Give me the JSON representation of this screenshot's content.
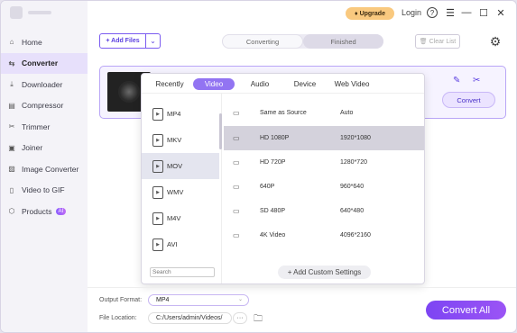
{
  "sidebar": {
    "items": [
      {
        "label": "Home",
        "icon": "home-icon"
      },
      {
        "label": "Converter",
        "icon": "converter-icon",
        "active": true
      },
      {
        "label": "Downloader",
        "icon": "download-icon"
      },
      {
        "label": "Compressor",
        "icon": "compress-icon"
      },
      {
        "label": "Trimmer",
        "icon": "scissors-icon"
      },
      {
        "label": "Joiner",
        "icon": "joiner-icon"
      },
      {
        "label": "Image Converter",
        "icon": "image-icon"
      },
      {
        "label": "Video to GIF",
        "icon": "gif-icon"
      },
      {
        "label": "Products",
        "icon": "products-icon",
        "badge": "AI"
      }
    ]
  },
  "topbar": {
    "upgrade_label": "Upgrade",
    "login_label": "Login",
    "help_glyph": "?",
    "menu_glyph": "☰",
    "minimize_glyph": "—",
    "maximize_glyph": "☐",
    "close_glyph": "✕"
  },
  "toolbar": {
    "add_files_label": "+ Add Files",
    "tabs": [
      "Converting",
      "Finished"
    ],
    "clear_list_label": "Clear List"
  },
  "file_card": {
    "convert_label": "Convert"
  },
  "format_popup": {
    "tabs": [
      "Recently",
      "Video",
      "Audio",
      "Device",
      "Web Video"
    ],
    "active_tab": "Video",
    "formats": [
      "MP4",
      "MKV",
      "MOV",
      "WMV",
      "M4V",
      "AVI"
    ],
    "selected_format": "MOV",
    "resolutions": [
      {
        "name": "Same as Source",
        "value": "Auto"
      },
      {
        "name": "HD 1080P",
        "value": "1920*1080"
      },
      {
        "name": "HD 720P",
        "value": "1280*720"
      },
      {
        "name": "640P",
        "value": "960*640"
      },
      {
        "name": "SD 480P",
        "value": "640*480"
      },
      {
        "name": "4K Video",
        "value": "4096*2160"
      }
    ],
    "selected_resolution": "HD 1080P",
    "search_placeholder": "Search",
    "add_custom_label": "+ Add Custom Settings"
  },
  "bottom": {
    "output_format_label": "Output Format:",
    "output_format_value": "MP4",
    "file_location_label": "File Location:",
    "file_location_value": "C:/Users/admin/Videos/",
    "more_glyph": "···",
    "convert_all_label": "Convert All"
  },
  "colors": {
    "accent": "#7d45f3",
    "active_nav_bg": "#e7e0fb",
    "upgrade_bg": "#f9c97f"
  }
}
